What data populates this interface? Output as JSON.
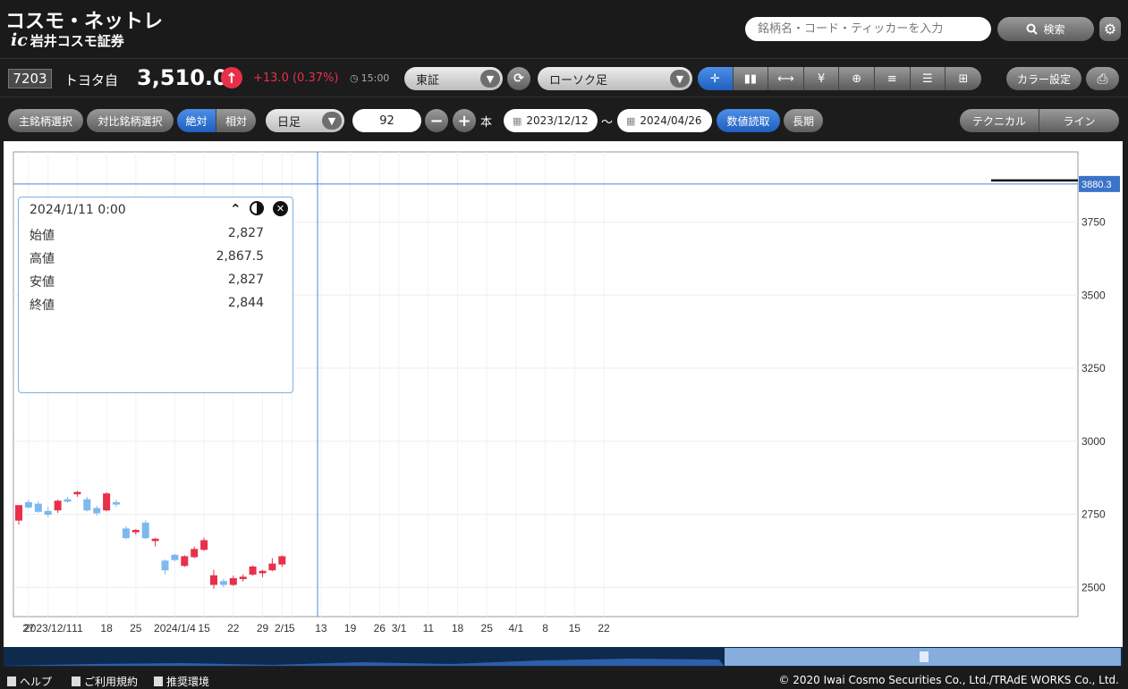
{
  "header": {
    "logo_main": "コスモ・ネットレ",
    "logo_mark": "ic",
    "logo_sub": "岩井コスモ証券",
    "search_placeholder": "銘柄名・コード・ティッカーを入力",
    "search_button": "検索",
    "settings_icon": "gear-icon"
  },
  "quote": {
    "code": "7203",
    "name": "トヨタ自",
    "price": "3,510.0",
    "direction_icon": "up-arrow-icon",
    "change": "+13.0 (0.37%)",
    "time": "15:00",
    "up_color": "#e8304a"
  },
  "toolbar": {
    "market": "東証",
    "chart_type": "ローソク足",
    "tools": [
      "crosshair-icon",
      "volume-icon",
      "horizontal-line-icon",
      "yen-icon",
      "zoom-icon",
      "list-icon",
      "search-list-icon",
      "grid-icon"
    ],
    "color_settings": "カラー設定",
    "print_icon": "print-icon"
  },
  "controls": {
    "main_symbol": "主銘柄選択",
    "compare_symbol": "対比銘柄選択",
    "absolute": "絶対",
    "relative": "相対",
    "period": "日足",
    "count": "92",
    "count_unit": "本",
    "start_date": "2023/12/12",
    "tilde": "〜",
    "end_date": "2024/04/26",
    "value_read": "数値読取",
    "long_term": "長期",
    "technical": "テクニカル",
    "line": "ライン"
  },
  "info": {
    "date": "2024/1/11 0:00",
    "rows": [
      {
        "label": "始値",
        "value": "2,827"
      },
      {
        "label": "高値",
        "value": "2,867.5"
      },
      {
        "label": "安値",
        "value": "2,827"
      },
      {
        "label": "終値",
        "value": "2,844"
      }
    ]
  },
  "chart_data": {
    "type": "candlestick",
    "crosshair_price": "3880.3",
    "y_ticks": [
      "3750",
      "3500",
      "3250",
      "3000",
      "2750",
      "2500"
    ],
    "y_tick_values": [
      3750,
      3500,
      3250,
      3000,
      2750,
      2500
    ],
    "ylim": [
      2400,
      3990
    ],
    "x_tick_labels": [
      "27",
      "2023/12/1",
      "11",
      "18",
      "25",
      "2024/1/4",
      "15",
      "22",
      "29",
      "2/1",
      "5",
      "13",
      "19",
      "26",
      "3/1",
      "11",
      "18",
      "25",
      "4/1",
      "8",
      "15",
      "22"
    ],
    "x_tick_index": [
      1,
      3,
      6,
      9,
      12,
      16,
      19,
      22,
      25,
      27,
      28,
      31,
      34,
      37,
      39,
      42,
      45,
      48,
      51,
      54,
      57,
      60
    ],
    "up_color": "#e8304a",
    "down_color": "#7db8ee",
    "candles": [
      {
        "o": 2730,
        "h": 2770,
        "l": 2715,
        "c": 2780
      },
      {
        "o": 2790,
        "h": 2800,
        "l": 2770,
        "c": 2775
      },
      {
        "o": 2785,
        "h": 2795,
        "l": 2755,
        "c": 2760
      },
      {
        "o": 2760,
        "h": 2775,
        "l": 2740,
        "c": 2750
      },
      {
        "o": 2765,
        "h": 2800,
        "l": 2755,
        "c": 2795
      },
      {
        "o": 2800,
        "h": 2810,
        "l": 2790,
        "c": 2795
      },
      {
        "o": 2820,
        "h": 2830,
        "l": 2810,
        "c": 2825
      },
      {
        "o": 2800,
        "h": 2810,
        "l": 2760,
        "c": 2765
      },
      {
        "o": 2770,
        "h": 2780,
        "l": 2745,
        "c": 2755
      },
      {
        "o": 2765,
        "h": 2825,
        "l": 2760,
        "c": 2820
      },
      {
        "o": 2790,
        "h": 2800,
        "l": 2775,
        "c": 2785
      },
      {
        "o": 2700,
        "h": 2710,
        "l": 2665,
        "c": 2670
      },
      {
        "o": 2690,
        "h": 2700,
        "l": 2680,
        "c": 2695
      },
      {
        "o": 2720,
        "h": 2730,
        "l": 2665,
        "c": 2670
      },
      {
        "o": 2660,
        "h": 2670,
        "l": 2640,
        "c": 2665
      },
      {
        "o": 2590,
        "h": 2595,
        "l": 2545,
        "c": 2560
      },
      {
        "o": 2610,
        "h": 2615,
        "l": 2590,
        "c": 2595
      },
      {
        "o": 2575,
        "h": 2610,
        "l": 2570,
        "c": 2605
      },
      {
        "o": 2605,
        "h": 2640,
        "l": 2600,
        "c": 2630
      },
      {
        "o": 2630,
        "h": 2670,
        "l": 2625,
        "c": 2660
      },
      {
        "o": 2510,
        "h": 2560,
        "l": 2495,
        "c": 2540
      },
      {
        "o": 2520,
        "h": 2530,
        "l": 2500,
        "c": 2510
      },
      {
        "o": 2510,
        "h": 2540,
        "l": 2505,
        "c": 2530
      },
      {
        "o": 2530,
        "h": 2545,
        "l": 2520,
        "c": 2535
      },
      {
        "o": 2545,
        "h": 2575,
        "l": 2540,
        "c": 2570
      },
      {
        "o": 2550,
        "h": 2560,
        "l": 2535,
        "c": 2555
      },
      {
        "o": 2560,
        "h": 2600,
        "l": 2555,
        "c": 2580
      },
      {
        "o": 2580,
        "h": 2610,
        "l": 2570,
        "c": 2605
      }
    ]
  },
  "footer": {
    "help": "ヘルプ",
    "terms": "ご利用規約",
    "env": "推奨環境",
    "copyright": "© 2020 Iwai Cosmo Securities Co., Ltd./TRAdE WORKS Co., Ltd."
  }
}
